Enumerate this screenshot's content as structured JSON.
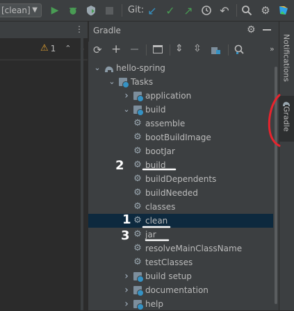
{
  "toolbar": {
    "run_config_label": "[clean]",
    "git_label": "Git:",
    "icons": [
      "run-icon",
      "debug-icon",
      "coverage-icon",
      "stop-icon",
      "git-update-icon",
      "git-commit-icon",
      "git-push-icon",
      "history-icon",
      "rollback-icon",
      "search-icon",
      "settings-icon",
      "jetbrains-logo-icon"
    ]
  },
  "editor": {
    "warning_count": "1"
  },
  "gradle": {
    "title": "Gradle",
    "toolbar_icons": [
      "refresh-icon",
      "add-icon",
      "remove-icon",
      "toggle-offline-icon",
      "expand-all-icon",
      "collapse-all-icon",
      "dependencies-icon",
      "analyze-icon"
    ],
    "tree": [
      {
        "label": "hello-spring",
        "kind": "project",
        "expanded": true
      },
      {
        "label": "Tasks",
        "kind": "folder",
        "expanded": true
      },
      {
        "label": "application",
        "kind": "folder",
        "expanded": false
      },
      {
        "label": "build",
        "kind": "folder",
        "expanded": true
      },
      {
        "label": "assemble",
        "kind": "task"
      },
      {
        "label": "bootBuildImage",
        "kind": "task"
      },
      {
        "label": "bootJar",
        "kind": "task"
      },
      {
        "label": "build",
        "kind": "task"
      },
      {
        "label": "buildDependents",
        "kind": "task"
      },
      {
        "label": "buildNeeded",
        "kind": "task"
      },
      {
        "label": "classes",
        "kind": "task"
      },
      {
        "label": "clean",
        "kind": "task",
        "selected": true
      },
      {
        "label": "jar",
        "kind": "task"
      },
      {
        "label": "resolveMainClassName",
        "kind": "task"
      },
      {
        "label": "testClasses",
        "kind": "task"
      },
      {
        "label": "build setup",
        "kind": "folder",
        "expanded": false
      },
      {
        "label": "documentation",
        "kind": "folder",
        "expanded": false
      },
      {
        "label": "help",
        "kind": "folder",
        "expanded": false
      }
    ]
  },
  "right_stripe": {
    "tabs": [
      "Notifications",
      "Gradle"
    ]
  },
  "annotations": [
    "1",
    "2",
    "3"
  ],
  "colors": {
    "background": "#2b2b2b",
    "panel": "#3c3f41",
    "selection": "#0d293e",
    "run_green": "#499c54",
    "git_blue": "#3592c4",
    "annotation_red": "#e8232d"
  }
}
